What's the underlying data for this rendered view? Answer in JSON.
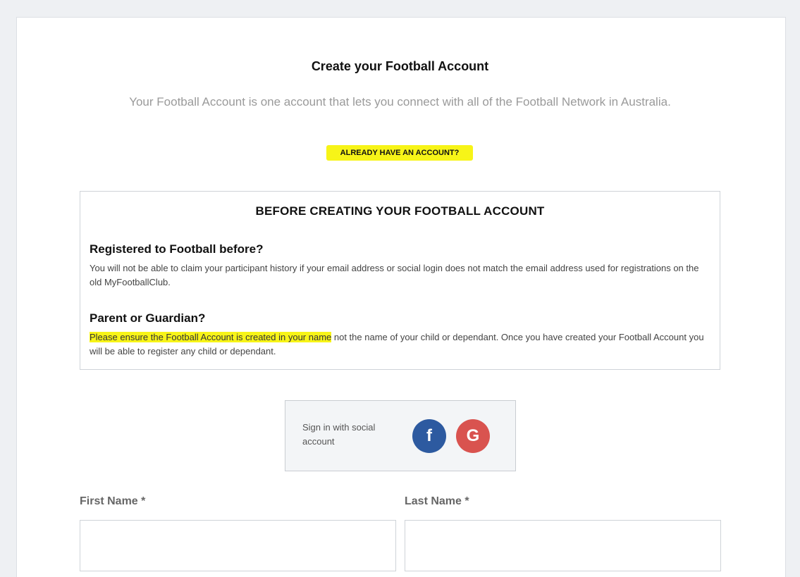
{
  "header": {
    "title": "Create your Football Account",
    "subtitle": "Your Football Account is one account that lets you connect with all of the Football Network in Australia.",
    "already_link": "ALREADY HAVE AN ACCOUNT?"
  },
  "info_box": {
    "heading": "BEFORE CREATING YOUR FOOTBALL ACCOUNT",
    "registered_title": "Registered to Football before?",
    "registered_body": "You will not be able to claim your participant history if your email address or social login does not match the email address used for registrations on the old MyFootballClub.",
    "parent_title": "Parent or Guardian?",
    "parent_body_highlight": "Please ensure the Football Account is created in your name",
    "parent_body_rest": " not the name of your child or dependant. Once you have created your Football Account you will be able to register any child or dependant."
  },
  "social": {
    "text": "Sign in with social account",
    "facebook_glyph": "f",
    "google_glyph": "G",
    "facebook_color": "#2d5aa0",
    "google_color": "#d9534f"
  },
  "form": {
    "first_name_label": "First Name *",
    "first_name_value": "",
    "last_name_label": "Last Name *",
    "last_name_value": ""
  },
  "colors": {
    "highlight": "#f7f418"
  }
}
